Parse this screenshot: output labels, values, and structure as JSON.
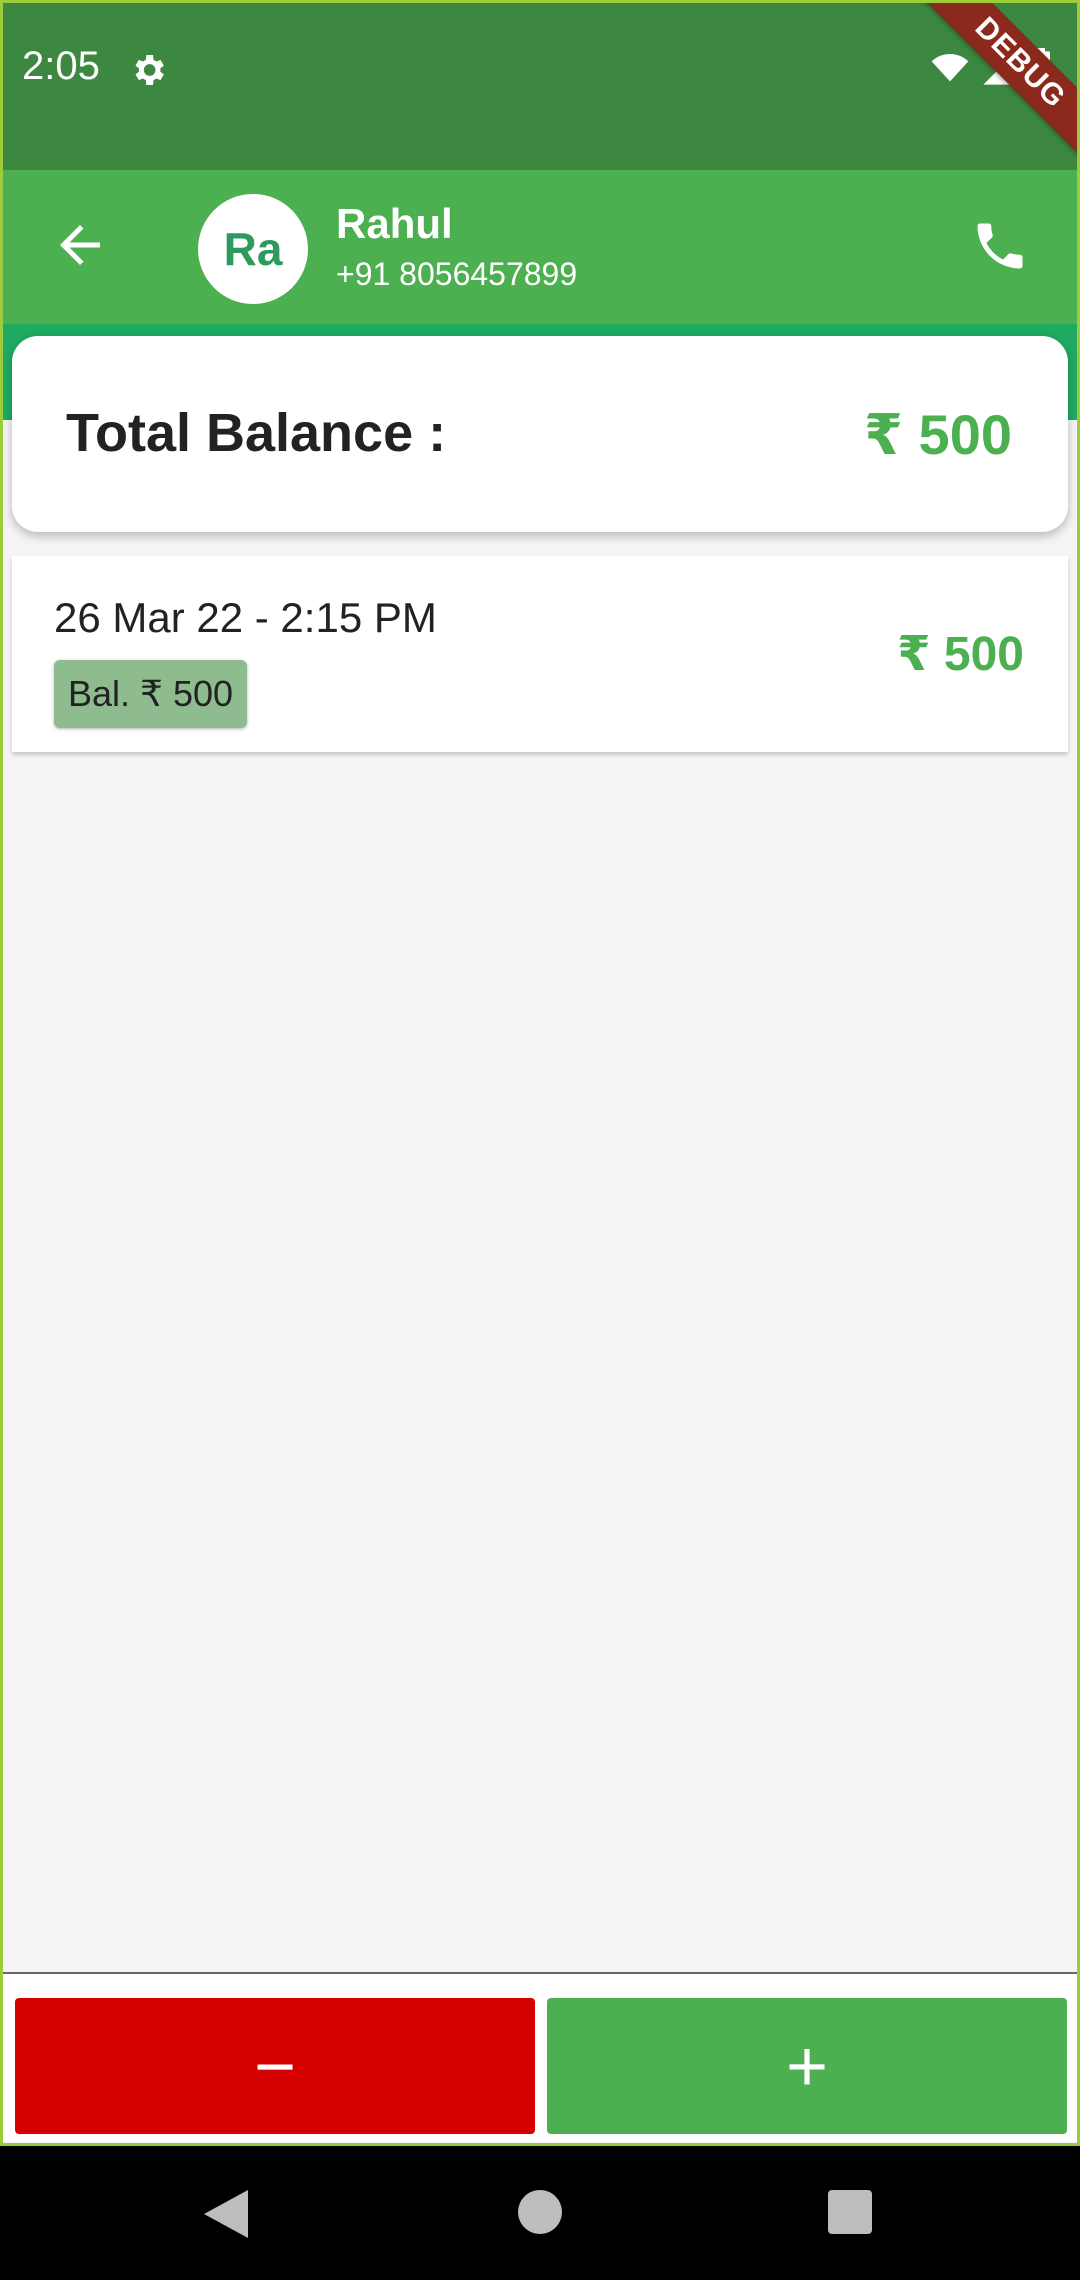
{
  "status_bar": {
    "time": "2:05",
    "debug": "DEBUG"
  },
  "header": {
    "avatar_initials": "Ra",
    "name": "Rahul",
    "phone": "+91 8056457899"
  },
  "balance": {
    "label": "Total Balance :",
    "value": "₹ 500"
  },
  "transactions": [
    {
      "date": "26 Mar 22 - 2:15 PM",
      "balance": "Bal. ₹ 500",
      "amount": "₹ 500"
    }
  ],
  "actions": {
    "minus_label": "−",
    "plus_label": "+"
  },
  "colors": {
    "primary": "#4caf50",
    "status": "#3d8841",
    "minus": "#d50000",
    "badge": "#8fbc8f"
  }
}
